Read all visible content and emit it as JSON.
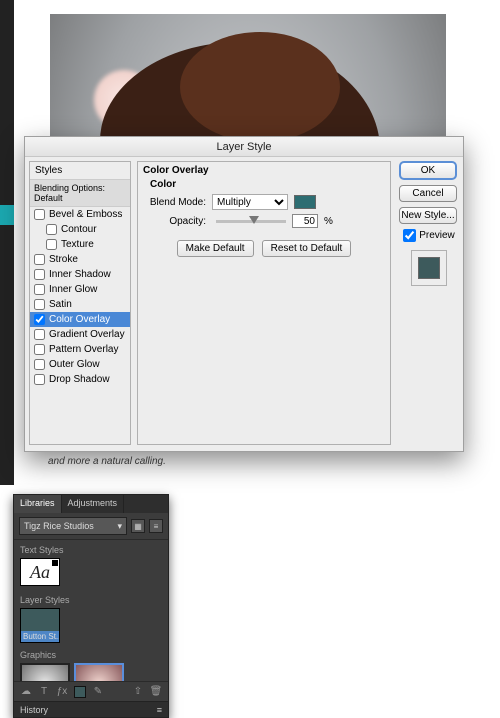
{
  "photo_caption": "and more a natural calling.",
  "dialog": {
    "title": "Layer Style",
    "styles_header": "Styles",
    "blending_row": "Blending Options: Default",
    "effects": [
      {
        "label": "Bevel & Emboss",
        "checked": false,
        "indent": false
      },
      {
        "label": "Contour",
        "checked": false,
        "indent": true
      },
      {
        "label": "Texture",
        "checked": false,
        "indent": true
      },
      {
        "label": "Stroke",
        "checked": false,
        "indent": false
      },
      {
        "label": "Inner Shadow",
        "checked": false,
        "indent": false
      },
      {
        "label": "Inner Glow",
        "checked": false,
        "indent": false
      },
      {
        "label": "Satin",
        "checked": false,
        "indent": false
      },
      {
        "label": "Color Overlay",
        "checked": true,
        "indent": false,
        "selected": true
      },
      {
        "label": "Gradient Overlay",
        "checked": false,
        "indent": false
      },
      {
        "label": "Pattern Overlay",
        "checked": false,
        "indent": false
      },
      {
        "label": "Outer Glow",
        "checked": false,
        "indent": false
      },
      {
        "label": "Drop Shadow",
        "checked": false,
        "indent": false
      }
    ],
    "center": {
      "title": "Color Overlay",
      "sub": "Color",
      "blend_label": "Blend Mode:",
      "blend_value": "Multiply",
      "swatch_color": "#2d6d72",
      "opacity_label": "Opacity:",
      "opacity_value": "50",
      "opacity_unit": "%",
      "make_default": "Make Default",
      "reset_default": "Reset to Default"
    },
    "buttons": {
      "ok": "OK",
      "cancel": "Cancel",
      "new_style": "New Style...",
      "preview_label": "Preview",
      "preview_checked": true,
      "preview_color": "#3d5a5c"
    }
  },
  "panel": {
    "tabs": {
      "libraries": "Libraries",
      "adjustments": "Adjustments"
    },
    "library_name": "Tigz Rice Studios",
    "sections": {
      "text_styles": "Text Styles",
      "text_thumb": "Aa",
      "layer_styles": "Layer Styles",
      "layer_style_name": "Button St...",
      "graphics": "Graphics"
    },
    "history": "History"
  }
}
